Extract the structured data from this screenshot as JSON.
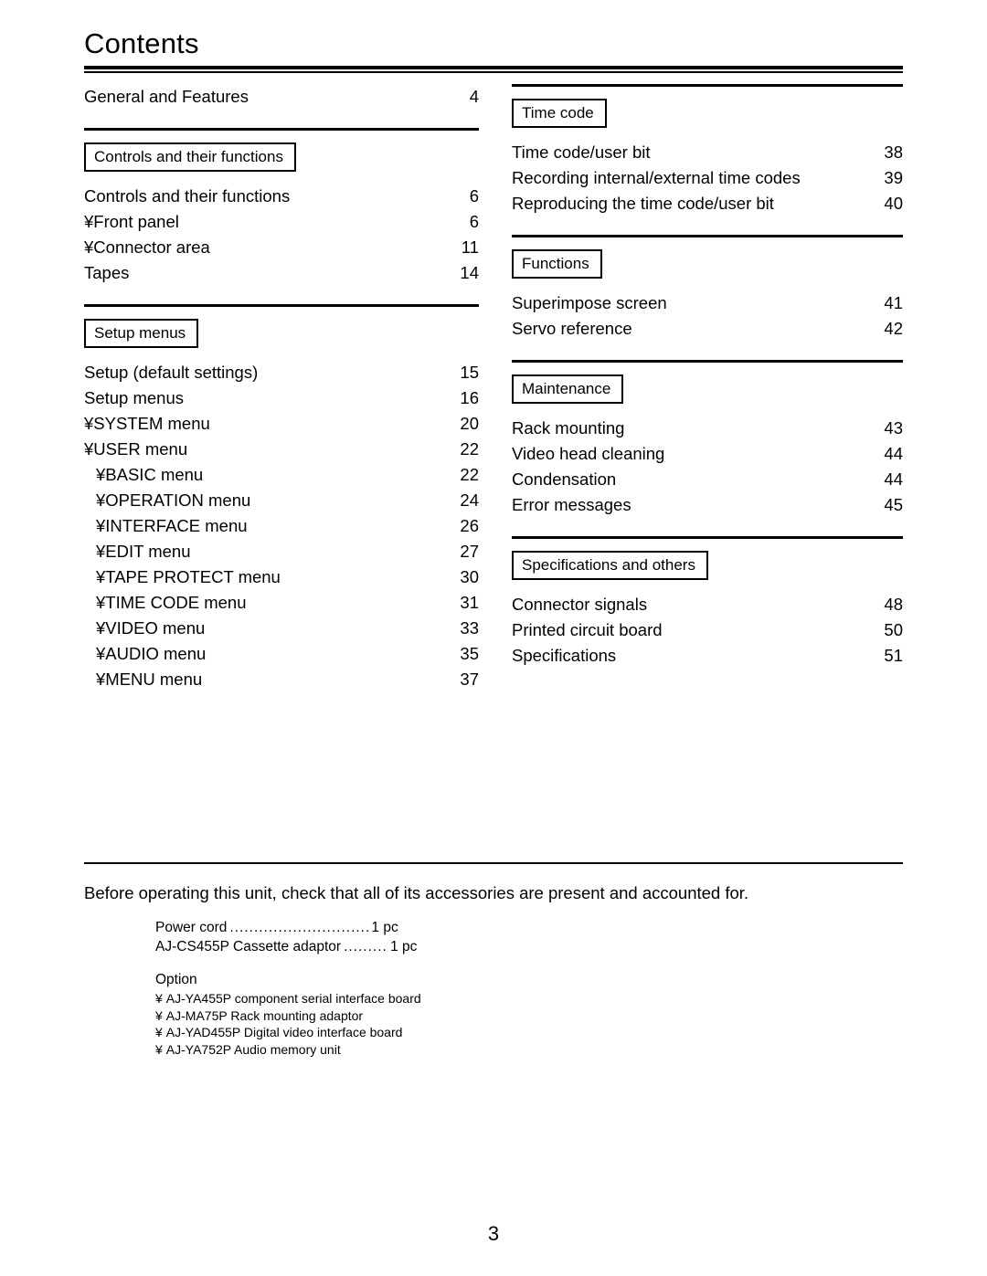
{
  "document": {
    "title": "Contents",
    "folio": "3",
    "bullet": "¥"
  },
  "left_column": {
    "standalone_entries": [
      {
        "label": "General and Features",
        "page": "4"
      }
    ],
    "sections": [
      {
        "heading": "Controls and their functions",
        "entries": [
          {
            "label": "Controls and their functions",
            "page": "6",
            "level": 1,
            "bullet": false
          },
          {
            "label": "Front panel",
            "page": "6",
            "level": 1,
            "bullet": true
          },
          {
            "label": "Connector area",
            "page": "11",
            "level": 1,
            "bullet": true
          },
          {
            "label": "Tapes",
            "page": "14",
            "level": 1,
            "bullet": false
          }
        ]
      },
      {
        "heading": "Setup menus",
        "entries": [
          {
            "label": "Setup (default settings)",
            "page": "15",
            "level": 1,
            "bullet": false
          },
          {
            "label": "Setup menus",
            "page": "16",
            "level": 1,
            "bullet": false
          },
          {
            "label": "SYSTEM menu",
            "page": "20",
            "level": 1,
            "bullet": true
          },
          {
            "label": "USER menu",
            "page": "22",
            "level": 1,
            "bullet": true
          },
          {
            "label": "BASIC menu",
            "page": "22",
            "level": 2,
            "bullet": true
          },
          {
            "label": "OPERATION menu",
            "page": "24",
            "level": 2,
            "bullet": true
          },
          {
            "label": "INTERFACE menu",
            "page": "26",
            "level": 2,
            "bullet": true
          },
          {
            "label": "EDIT menu",
            "page": "27",
            "level": 2,
            "bullet": true
          },
          {
            "label": "TAPE PROTECT menu",
            "page": "30",
            "level": 2,
            "bullet": true
          },
          {
            "label": "TIME CODE menu",
            "page": "31",
            "level": 2,
            "bullet": true
          },
          {
            "label": "VIDEO menu",
            "page": "33",
            "level": 2,
            "bullet": true
          },
          {
            "label": "AUDIO menu",
            "page": "35",
            "level": 2,
            "bullet": true
          },
          {
            "label": "MENU menu",
            "page": "37",
            "level": 2,
            "bullet": true
          }
        ]
      }
    ]
  },
  "right_column": {
    "sections": [
      {
        "heading": "Time code",
        "entries": [
          {
            "label": "Time code/user bit",
            "page": "38"
          },
          {
            "label": "Recording internal/external time codes",
            "page": "39"
          },
          {
            "label": "Reproducing the time code/user bit",
            "page": "40"
          }
        ]
      },
      {
        "heading": "Functions",
        "entries": [
          {
            "label": "Superimpose screen",
            "page": "41"
          },
          {
            "label": "Servo reference",
            "page": "42"
          }
        ]
      },
      {
        "heading": "Maintenance",
        "entries": [
          {
            "label": "Rack mounting",
            "page": "43"
          },
          {
            "label": "Video head cleaning",
            "page": "44"
          },
          {
            "label": "Condensation",
            "page": "44"
          },
          {
            "label": "Error messages",
            "page": "45"
          }
        ]
      },
      {
        "heading": "Specifications and others",
        "entries": [
          {
            "label": "Connector signals",
            "page": "48"
          },
          {
            "label": "Printed circuit board",
            "page": "50"
          },
          {
            "label": "Specifications",
            "page": "51"
          }
        ]
      }
    ]
  },
  "accessories": {
    "intro": "Before operating this unit, check that all of its accessories are present and accounted for.",
    "items": [
      {
        "label": "Power cord",
        "qty": "1 pc"
      },
      {
        "label": "AJ-CS455P Cassette adaptor",
        "qty": "1 pc"
      }
    ],
    "option_title": "Option",
    "options": [
      "AJ-YA455P component serial interface board",
      "AJ-MA75P Rack mounting adaptor",
      "AJ-YAD455P Digital video interface board",
      "AJ-YA752P Audio memory unit"
    ]
  }
}
